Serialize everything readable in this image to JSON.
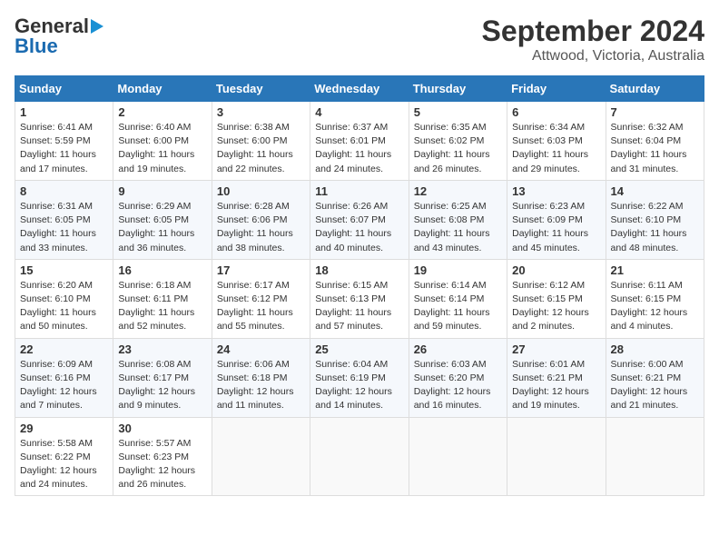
{
  "header": {
    "logo_general": "General",
    "logo_blue": "Blue",
    "title": "September 2024",
    "subtitle": "Attwood, Victoria, Australia"
  },
  "calendar": {
    "days_of_week": [
      "Sunday",
      "Monday",
      "Tuesday",
      "Wednesday",
      "Thursday",
      "Friday",
      "Saturday"
    ],
    "weeks": [
      [
        {
          "day": 1,
          "lines": [
            "Sunrise: 6:41 AM",
            "Sunset: 5:59 PM",
            "Daylight: 11 hours",
            "and 17 minutes."
          ]
        },
        {
          "day": 2,
          "lines": [
            "Sunrise: 6:40 AM",
            "Sunset: 6:00 PM",
            "Daylight: 11 hours",
            "and 19 minutes."
          ]
        },
        {
          "day": 3,
          "lines": [
            "Sunrise: 6:38 AM",
            "Sunset: 6:00 PM",
            "Daylight: 11 hours",
            "and 22 minutes."
          ]
        },
        {
          "day": 4,
          "lines": [
            "Sunrise: 6:37 AM",
            "Sunset: 6:01 PM",
            "Daylight: 11 hours",
            "and 24 minutes."
          ]
        },
        {
          "day": 5,
          "lines": [
            "Sunrise: 6:35 AM",
            "Sunset: 6:02 PM",
            "Daylight: 11 hours",
            "and 26 minutes."
          ]
        },
        {
          "day": 6,
          "lines": [
            "Sunrise: 6:34 AM",
            "Sunset: 6:03 PM",
            "Daylight: 11 hours",
            "and 29 minutes."
          ]
        },
        {
          "day": 7,
          "lines": [
            "Sunrise: 6:32 AM",
            "Sunset: 6:04 PM",
            "Daylight: 11 hours",
            "and 31 minutes."
          ]
        }
      ],
      [
        {
          "day": 8,
          "lines": [
            "Sunrise: 6:31 AM",
            "Sunset: 6:05 PM",
            "Daylight: 11 hours",
            "and 33 minutes."
          ]
        },
        {
          "day": 9,
          "lines": [
            "Sunrise: 6:29 AM",
            "Sunset: 6:05 PM",
            "Daylight: 11 hours",
            "and 36 minutes."
          ]
        },
        {
          "day": 10,
          "lines": [
            "Sunrise: 6:28 AM",
            "Sunset: 6:06 PM",
            "Daylight: 11 hours",
            "and 38 minutes."
          ]
        },
        {
          "day": 11,
          "lines": [
            "Sunrise: 6:26 AM",
            "Sunset: 6:07 PM",
            "Daylight: 11 hours",
            "and 40 minutes."
          ]
        },
        {
          "day": 12,
          "lines": [
            "Sunrise: 6:25 AM",
            "Sunset: 6:08 PM",
            "Daylight: 11 hours",
            "and 43 minutes."
          ]
        },
        {
          "day": 13,
          "lines": [
            "Sunrise: 6:23 AM",
            "Sunset: 6:09 PM",
            "Daylight: 11 hours",
            "and 45 minutes."
          ]
        },
        {
          "day": 14,
          "lines": [
            "Sunrise: 6:22 AM",
            "Sunset: 6:10 PM",
            "Daylight: 11 hours",
            "and 48 minutes."
          ]
        }
      ],
      [
        {
          "day": 15,
          "lines": [
            "Sunrise: 6:20 AM",
            "Sunset: 6:10 PM",
            "Daylight: 11 hours",
            "and 50 minutes."
          ]
        },
        {
          "day": 16,
          "lines": [
            "Sunrise: 6:18 AM",
            "Sunset: 6:11 PM",
            "Daylight: 11 hours",
            "and 52 minutes."
          ]
        },
        {
          "day": 17,
          "lines": [
            "Sunrise: 6:17 AM",
            "Sunset: 6:12 PM",
            "Daylight: 11 hours",
            "and 55 minutes."
          ]
        },
        {
          "day": 18,
          "lines": [
            "Sunrise: 6:15 AM",
            "Sunset: 6:13 PM",
            "Daylight: 11 hours",
            "and 57 minutes."
          ]
        },
        {
          "day": 19,
          "lines": [
            "Sunrise: 6:14 AM",
            "Sunset: 6:14 PM",
            "Daylight: 11 hours",
            "and 59 minutes."
          ]
        },
        {
          "day": 20,
          "lines": [
            "Sunrise: 6:12 AM",
            "Sunset: 6:15 PM",
            "Daylight: 12 hours",
            "and 2 minutes."
          ]
        },
        {
          "day": 21,
          "lines": [
            "Sunrise: 6:11 AM",
            "Sunset: 6:15 PM",
            "Daylight: 12 hours",
            "and 4 minutes."
          ]
        }
      ],
      [
        {
          "day": 22,
          "lines": [
            "Sunrise: 6:09 AM",
            "Sunset: 6:16 PM",
            "Daylight: 12 hours",
            "and 7 minutes."
          ]
        },
        {
          "day": 23,
          "lines": [
            "Sunrise: 6:08 AM",
            "Sunset: 6:17 PM",
            "Daylight: 12 hours",
            "and 9 minutes."
          ]
        },
        {
          "day": 24,
          "lines": [
            "Sunrise: 6:06 AM",
            "Sunset: 6:18 PM",
            "Daylight: 12 hours",
            "and 11 minutes."
          ]
        },
        {
          "day": 25,
          "lines": [
            "Sunrise: 6:04 AM",
            "Sunset: 6:19 PM",
            "Daylight: 12 hours",
            "and 14 minutes."
          ]
        },
        {
          "day": 26,
          "lines": [
            "Sunrise: 6:03 AM",
            "Sunset: 6:20 PM",
            "Daylight: 12 hours",
            "and 16 minutes."
          ]
        },
        {
          "day": 27,
          "lines": [
            "Sunrise: 6:01 AM",
            "Sunset: 6:21 PM",
            "Daylight: 12 hours",
            "and 19 minutes."
          ]
        },
        {
          "day": 28,
          "lines": [
            "Sunrise: 6:00 AM",
            "Sunset: 6:21 PM",
            "Daylight: 12 hours",
            "and 21 minutes."
          ]
        }
      ],
      [
        {
          "day": 29,
          "lines": [
            "Sunrise: 5:58 AM",
            "Sunset: 6:22 PM",
            "Daylight: 12 hours",
            "and 24 minutes."
          ]
        },
        {
          "day": 30,
          "lines": [
            "Sunrise: 5:57 AM",
            "Sunset: 6:23 PM",
            "Daylight: 12 hours",
            "and 26 minutes."
          ]
        },
        null,
        null,
        null,
        null,
        null
      ]
    ]
  }
}
